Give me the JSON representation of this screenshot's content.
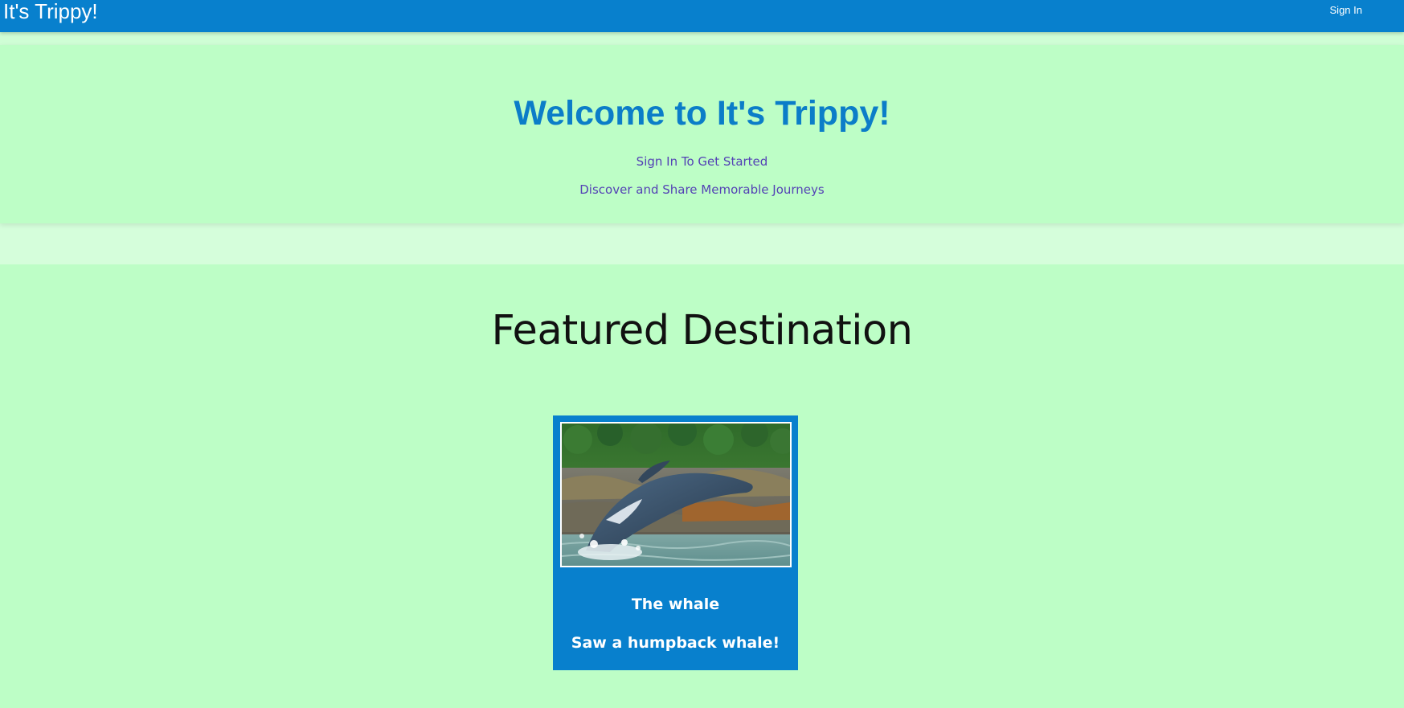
{
  "navbar": {
    "brand": "It's Trippy!",
    "sign_in_label": "Sign In"
  },
  "hero": {
    "title": "Welcome to It's Trippy!",
    "subtitle": "Sign In To Get Started",
    "tagline": "Discover and Share Memorable Journeys"
  },
  "featured": {
    "heading": "Featured Destination",
    "card": {
      "image_alt": "humpback-whale-breaching-photo",
      "title": "The whale",
      "description": "Saw a humpback whale!"
    }
  },
  "colors": {
    "primary": "#0880cd",
    "background": "#bdfec6",
    "hero_title": "#0b7dc8",
    "hero_text": "#5442b5"
  }
}
